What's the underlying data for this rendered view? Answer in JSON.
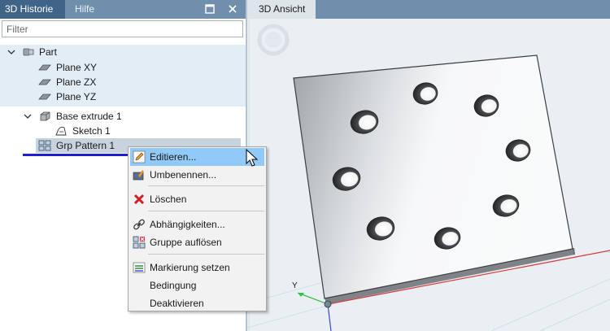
{
  "left_panel": {
    "tabs": [
      {
        "label": "3D Historie",
        "active": true
      },
      {
        "label": "Hilfe",
        "active": false
      }
    ],
    "filter": {
      "placeholder": "Filter",
      "value": ""
    },
    "tree": {
      "part": {
        "label": "Part",
        "icon": "part-icon"
      },
      "planes": [
        {
          "label": "Plane XY",
          "icon": "plane-icon"
        },
        {
          "label": "Plane ZX",
          "icon": "plane-icon"
        },
        {
          "label": "Plane YZ",
          "icon": "plane-icon"
        }
      ],
      "base_extrude": {
        "label": "Base extrude 1",
        "icon": "extrude-icon"
      },
      "sketch": {
        "label": "Sketch 1",
        "icon": "sketch-icon"
      },
      "grp_pattern": {
        "label": "Grp Pattern 1",
        "icon": "pattern-icon",
        "selected": true
      }
    }
  },
  "view": {
    "tab_label": "3D Ansicht",
    "axis_y_label": "Y"
  },
  "context_menu": {
    "items": [
      {
        "label": "Editieren...",
        "icon": "pencil-icon",
        "highlighted": true
      },
      {
        "label": "Umbenennen...",
        "icon": "rename-icon"
      },
      {
        "label": "Löschen",
        "icon": "delete-icon"
      },
      {
        "label": "Abhängigkeiten...",
        "icon": "link-icon"
      },
      {
        "label": "Gruppe auflösen",
        "icon": "ungroup-icon"
      },
      {
        "label": "Markierung setzen",
        "icon": "marker-icon"
      },
      {
        "label": "Bedingung",
        "icon": ""
      },
      {
        "label": "Deaktivieren",
        "icon": ""
      }
    ]
  },
  "colors": {
    "tabbar": "#6f8fac",
    "active_tab": "#3f6488",
    "menu_highlight": "#91c9f7",
    "selection": "#c8d3de"
  }
}
